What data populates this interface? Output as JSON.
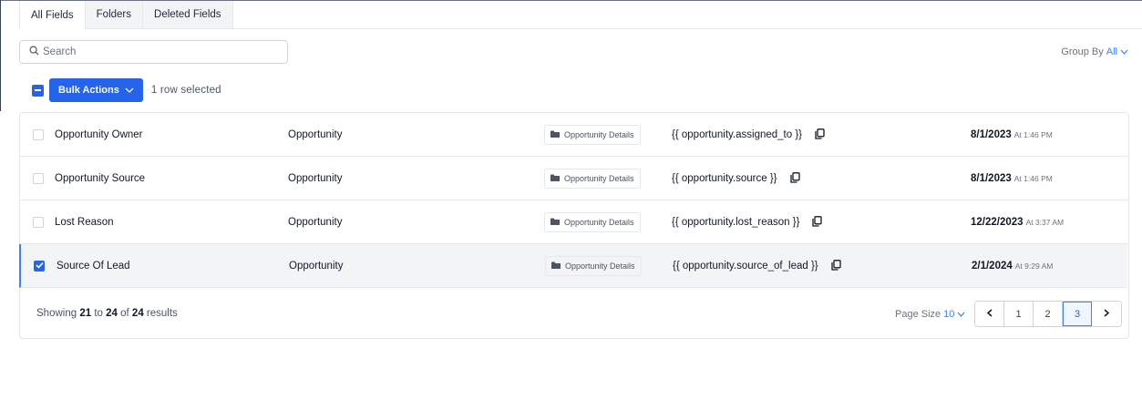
{
  "tabs": [
    {
      "label": "All Fields",
      "active": true
    },
    {
      "label": "Folders",
      "active": false
    },
    {
      "label": "Deleted Fields",
      "active": false
    }
  ],
  "search": {
    "placeholder": "Search",
    "value": ""
  },
  "group_by": {
    "label": "Group By",
    "value": "All"
  },
  "bulk": {
    "button_label": "Bulk Actions",
    "selected_text": "1 row selected"
  },
  "rows": [
    {
      "name": "Opportunity Owner",
      "object": "Opportunity",
      "folder": "Opportunity Details",
      "key": "{{ opportunity.assigned_to }}",
      "date": "8/1/2023",
      "time": "At 1:46 PM",
      "checked": false
    },
    {
      "name": "Opportunity Source",
      "object": "Opportunity",
      "folder": "Opportunity Details",
      "key": "{{ opportunity.source }}",
      "date": "8/1/2023",
      "time": "At 1:46 PM",
      "checked": false
    },
    {
      "name": "Lost Reason",
      "object": "Opportunity",
      "folder": "Opportunity Details",
      "key": "{{ opportunity.lost_reason }}",
      "date": "12/22/2023",
      "time": "At 3:37 AM",
      "checked": false
    },
    {
      "name": "Source Of Lead",
      "object": "Opportunity",
      "folder": "Opportunity Details",
      "key": "{{ opportunity.source_of_lead }}",
      "date": "2/1/2024",
      "time": "At 9:29 AM",
      "checked": true
    }
  ],
  "footer": {
    "showing_prefix": "Showing",
    "from": "21",
    "to_word": "to",
    "to": "24",
    "of_word": "of",
    "total": "24",
    "results_word": "results",
    "page_size_label": "Page Size",
    "page_size_value": "10",
    "pages": [
      "1",
      "2",
      "3"
    ],
    "current_page": "3"
  },
  "colors": {
    "accent": "#2563eb",
    "link": "#3b82f6"
  },
  "icons": [
    "search-icon",
    "chevron-down-icon",
    "folder-icon",
    "copy-icon",
    "chevron-left-icon",
    "chevron-right-icon",
    "check-icon"
  ]
}
